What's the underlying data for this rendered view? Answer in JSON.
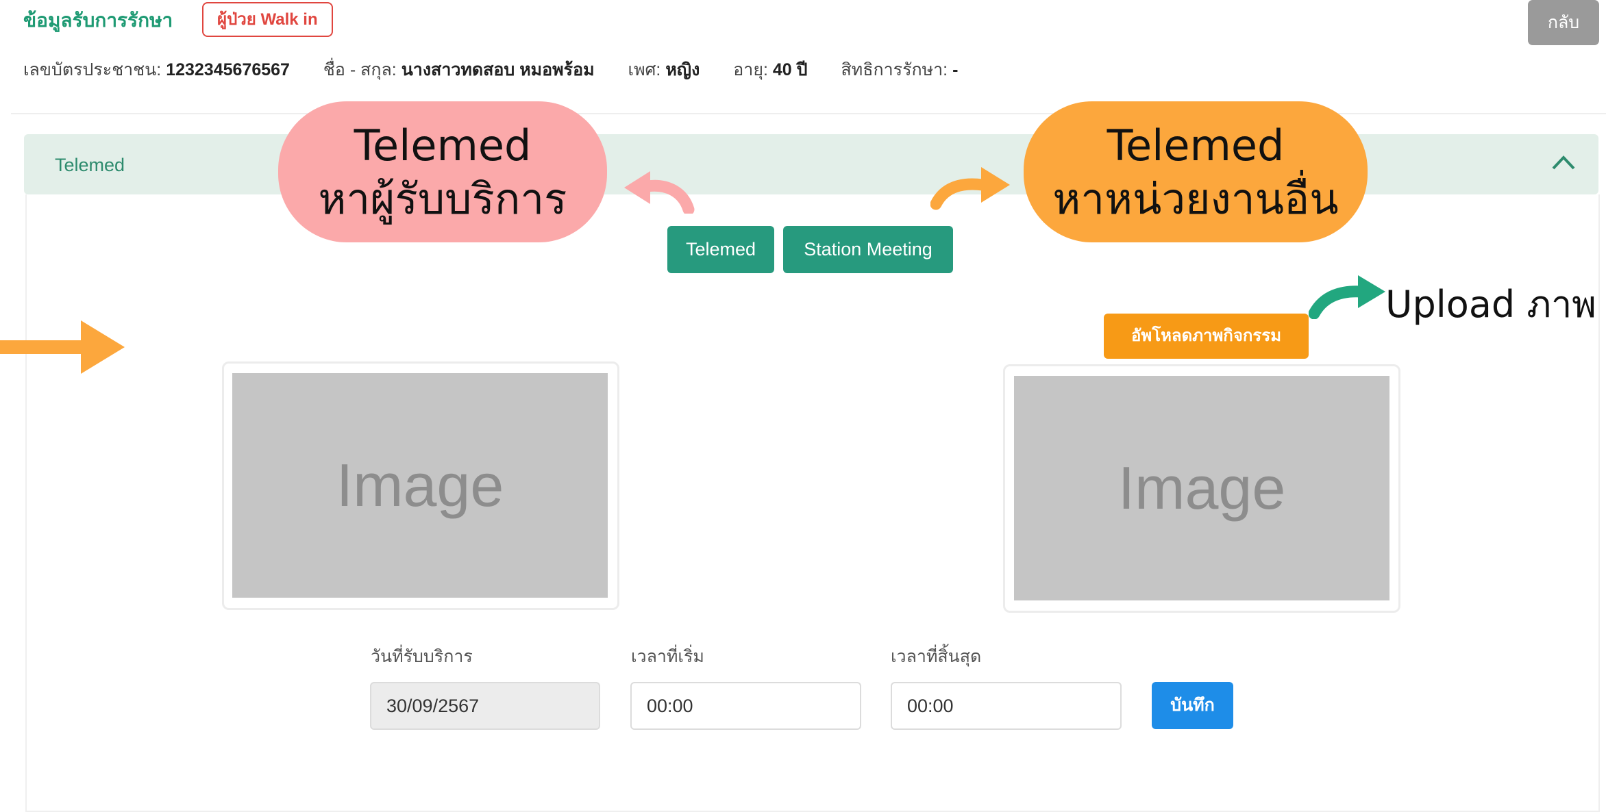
{
  "header": {
    "title": "ข้อมูลรับการรักษา",
    "badge": "ผู้ป่วย Walk in",
    "back_label": "กลับ"
  },
  "patient": {
    "id_label": "เลขบัตรประชาชน:",
    "id_value": "1232345676567",
    "name_label": "ชื่อ - สกุล:",
    "name_value": "นางสาวทดสอบ หมอพร้อม",
    "sex_label": "เพศ:",
    "sex_value": "หญิง",
    "age_label": "อายุ:",
    "age_value": "40 ปี",
    "rights_label": "สิทธิการรักษา:",
    "rights_value": "-"
  },
  "section": {
    "title": "Telemed"
  },
  "buttons": {
    "telemed": "Telemed",
    "station_meeting": "Station Meeting",
    "upload": "อัพโหลดภาพกิจกรรม",
    "save": "บันทึก"
  },
  "images": {
    "left_placeholder": "Image",
    "right_placeholder": "Image"
  },
  "form": {
    "date_label": "วันที่รับบริการ",
    "date_value": "30/09/2567",
    "start_label": "เวลาที่เริ่ม",
    "start_value": "00:00",
    "end_label": "เวลาที่สิ้นสุด",
    "end_value": "00:00"
  },
  "callouts": {
    "pink_line1": "Telemed",
    "pink_line2": "หาผู้รับบริการ",
    "orange_line1": "Telemed",
    "orange_line2": "หาหน่วยงานอื่น",
    "upload_note": "Upload ภาพ"
  },
  "colors": {
    "primary_green": "#279a7e",
    "title_green": "#1e9a73",
    "badge_red": "#e0463f",
    "upload_orange": "#f79a16",
    "save_blue": "#1e8de8",
    "callout_pink": "#fba9aa",
    "callout_orange": "#fca73d",
    "arrow_teal": "#22a77f"
  }
}
